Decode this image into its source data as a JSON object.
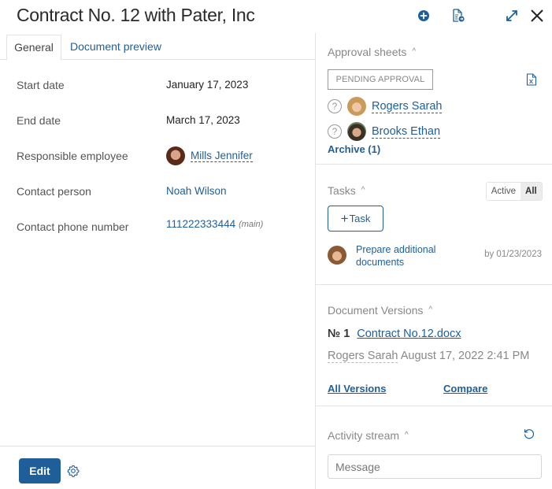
{
  "header": {
    "title": "Contract No. 12 with Pater, Inc",
    "icons": {
      "add": "plus-circle-icon",
      "doc_action": "document-arrow-icon",
      "expand": "expand-icon",
      "close": "close-icon"
    }
  },
  "tabs": [
    {
      "label": "General",
      "active": true
    },
    {
      "label": "Document preview",
      "active": false
    }
  ],
  "fields": [
    {
      "label": "Start date",
      "value": "January 17, 2023"
    },
    {
      "label": "End date",
      "value": "March 17, 2023"
    },
    {
      "label": "Responsible employee",
      "value": "Mills Jennifer"
    },
    {
      "label": "Contact person",
      "value": "Noah Wilson"
    },
    {
      "label": "Contact phone number",
      "value": "111222333444",
      "note": "(main)"
    }
  ],
  "footer": {
    "edit_label": "Edit",
    "settings_icon": "gear-icon"
  },
  "approval": {
    "title": "Approval sheets",
    "status": "PENDING APPROVAL",
    "approvers": [
      {
        "name": "Rogers Sarah",
        "state": "?"
      },
      {
        "name": "Brooks Ethan",
        "state": "?"
      }
    ],
    "archive_label": "Archive (1)"
  },
  "tasks": {
    "title": "Tasks",
    "filter_options": [
      "Active",
      "All"
    ],
    "filter_selected": "All",
    "add_label": "Task",
    "add_plus": "+",
    "items": [
      {
        "title": "Prepare additional documents",
        "due": "by 01/23/2023"
      }
    ]
  },
  "versions": {
    "title": "Document Versions",
    "items": [
      {
        "number": "№ 1",
        "file": "Contract No.12.docx",
        "author": "Rogers Sarah",
        "date": "August 17, 2022 2:41 PM"
      }
    ],
    "all_versions_label": "All Versions",
    "compare_label": "Compare"
  },
  "activity": {
    "title": "Activity stream",
    "message_placeholder": "Message",
    "message_value": ""
  },
  "colors": {
    "accent": "#1e5f99",
    "muted": "#888888",
    "border": "#e3e3e3"
  }
}
